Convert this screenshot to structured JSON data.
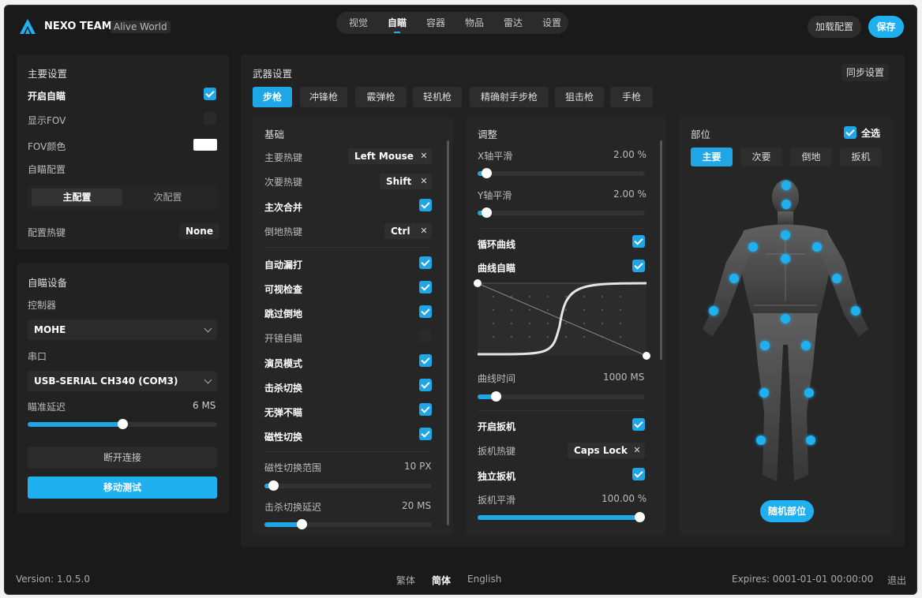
{
  "header": {
    "brand": "NEXO TEAM",
    "game": "Alive World",
    "nav": [
      "视觉",
      "自瞄",
      "容器",
      "物品",
      "雷达",
      "设置"
    ],
    "active_nav": "自瞄",
    "load_config": "加载配置",
    "save": "保存"
  },
  "main_settings": {
    "title": "主要设置",
    "enable_aim": "开启自瞄",
    "enable_aim_checked": true,
    "show_fov": "显示FOV",
    "show_fov_checked": false,
    "fov_color": "FOV颜色",
    "fov_color_value": "#ffffff",
    "aim_config": "自瞄配置",
    "config_tabs": [
      "主配置",
      "次配置"
    ],
    "config_hotkey": "配置热键",
    "config_hotkey_value": "None"
  },
  "aim_device": {
    "title": "自瞄设备",
    "controller_label": "控制器",
    "controller_value": "MOHE",
    "port_label": "串口",
    "port_value": "USB-SERIAL CH340 (COM3)",
    "delay_label": "瞄准延迟",
    "delay_value": "6 MS",
    "delay_fraction": 0.5,
    "disconnect": "断开连接",
    "move_test": "移动测试"
  },
  "weapon": {
    "title": "武器设置",
    "sync": "同步设置",
    "tabs": [
      "步枪",
      "冲锋枪",
      "霰弹枪",
      "轻机枪",
      "精确射手步枪",
      "狙击枪",
      "手枪"
    ],
    "active_tab": "步枪"
  },
  "basic": {
    "title": "基础",
    "primary_hotkey": "主要热键",
    "primary_hotkey_value": "Left Mouse",
    "secondary_hotkey": "次要热键",
    "secondary_hotkey_value": "Shift",
    "merge": "主次合并",
    "crouch_hotkey": "倒地热键",
    "crouch_hotkey_value": "Ctrl",
    "checks": [
      {
        "label": "自动漏打",
        "checked": true
      },
      {
        "label": "可视检查",
        "checked": true
      },
      {
        "label": "跳过倒地",
        "checked": true
      },
      {
        "label": "开镜自瞄",
        "checked": false
      },
      {
        "label": "演员模式",
        "checked": true
      },
      {
        "label": "击杀切换",
        "checked": true
      },
      {
        "label": "无弹不瞄",
        "checked": true
      },
      {
        "label": "磁性切换",
        "checked": true
      }
    ],
    "magnet_range": "磁性切换范围",
    "magnet_range_value": "10 PX",
    "magnet_range_fraction": 0.05,
    "kill_delay": "击杀切换延迟",
    "kill_delay_value": "20 MS",
    "kill_delay_fraction": 0.22
  },
  "adjust": {
    "title": "调整",
    "x_smooth": "X轴平滑",
    "x_smooth_value": "2.00 %",
    "x_smooth_fraction": 0.05,
    "y_smooth": "Y轴平滑",
    "y_smooth_value": "2.00 %",
    "y_smooth_fraction": 0.05,
    "loop_curve": "循环曲线",
    "curve_aim": "曲线自瞄",
    "curve_time": "曲线时间",
    "curve_time_value": "1000 MS",
    "curve_time_fraction": 0.11,
    "enable_trigger": "开启扳机",
    "trigger_hotkey": "扳机热键",
    "trigger_hotkey_value": "Caps Lock",
    "independent_trigger": "独立扳机",
    "trigger_smooth": "扳机平滑",
    "trigger_smooth_value": "100.00 %",
    "trigger_smooth_fraction": 1.0
  },
  "body": {
    "title": "部位",
    "select_all": "全选",
    "tabs": [
      "主要",
      "次要",
      "倒地",
      "扳机"
    ],
    "active_tab": "主要",
    "random": "随机部位"
  },
  "footer": {
    "version": "Version: 1.0.5.0",
    "langs": [
      "繁体",
      "简体",
      "English"
    ],
    "active_lang": "简体",
    "expires": "Expires: 0001-01-01 00:00:00",
    "logout": "退出"
  },
  "colors": {
    "accent": "#1fa6e6",
    "background": "#1a1a1a",
    "panel": "#222222"
  }
}
